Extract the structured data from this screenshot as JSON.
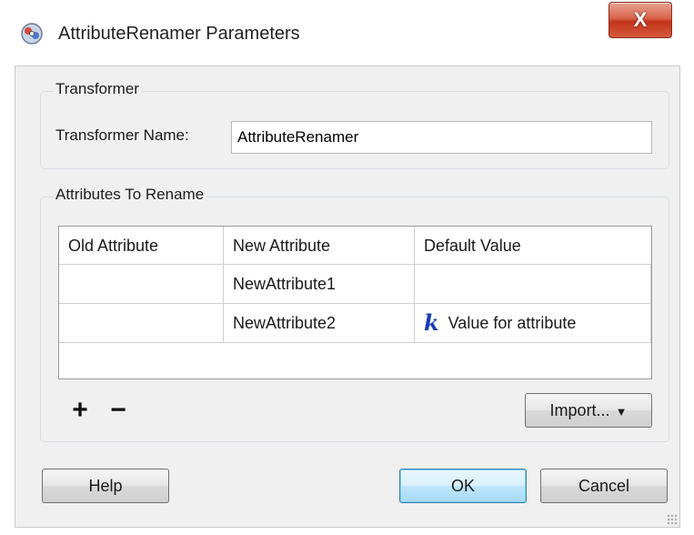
{
  "window": {
    "title": "AttributeRenamer Parameters",
    "close_label": "X"
  },
  "transformer_group": {
    "title": "Transformer",
    "name_label": "Transformer Name:",
    "name_value": "AttributeRenamer"
  },
  "attributes_group": {
    "title": "Attributes To Rename",
    "columns": [
      "Old Attribute",
      "New Attribute",
      "Default Value"
    ],
    "rows": [
      {
        "old": "",
        "new": "NewAttribute1",
        "default": ""
      },
      {
        "old": "",
        "new": "NewAttribute2",
        "default": "Value for attribute",
        "default_icon": "k-constant-icon"
      }
    ],
    "add_label": "+",
    "remove_label": "−",
    "import_label": "Import..."
  },
  "footer": {
    "help_label": "Help",
    "ok_label": "OK",
    "cancel_label": "Cancel"
  },
  "icons": {
    "app": "fme-transformer-icon",
    "k_glyph": "k"
  },
  "colors": {
    "close_button": "#c2341b",
    "default_button_accent": "#3c7fb1",
    "constant_icon": "#1a3bb8"
  }
}
